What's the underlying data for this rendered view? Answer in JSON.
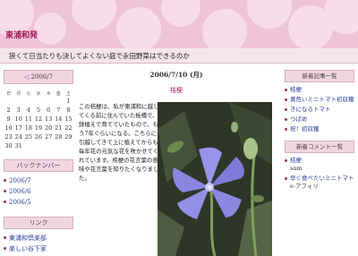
{
  "header": {
    "site_title": "東浦和発",
    "tagline": "狭くて日当たりも決してよくない庭で永田野菜はできるのか"
  },
  "calendar": {
    "prev_arrow": "◁",
    "title": "2006/7",
    "weekdays": [
      "日",
      "月",
      "火",
      "水",
      "木",
      "金",
      "土"
    ],
    "weeks": [
      [
        "",
        "",
        "",
        "",
        "",
        "",
        "1"
      ],
      [
        "2",
        "3",
        "4",
        "5",
        "6",
        "7",
        "8"
      ],
      [
        "9",
        "10",
        "11",
        "12",
        "13",
        "14",
        "15"
      ],
      [
        "16",
        "17",
        "18",
        "19",
        "20",
        "21",
        "22"
      ],
      [
        "23",
        "24",
        "25",
        "26",
        "27",
        "28",
        "29"
      ],
      [
        "30",
        "31",
        "",
        "",
        "",
        "",
        ""
      ]
    ]
  },
  "backnumber": {
    "heading": "バックナンバー",
    "items": [
      "2006/7",
      "2006/6",
      "2006/5"
    ]
  },
  "links": {
    "heading": "リンク",
    "items": [
      "東浦和倶楽部",
      "楽しい谷下家"
    ]
  },
  "article": {
    "date": "2006/7/10 (月)",
    "title": "桔梗",
    "body": "この桔梗は、私が東浦和に越してくる前に住んでいた板橋で、鉢植えで育てていたもので、もう7年ぐらいになる。こちらに引越してきて上に植えてからも毎年花の元気な花を咲かせてくれています。桔梗の花言葉の意味や花言葉を知りたくなりました。"
  },
  "recent_articles": {
    "heading": "新着記事一覧",
    "items": [
      "桔梗",
      "黄色いミニトマト初収穫",
      "きになるトマト",
      "つばめ",
      "祝！初収穫"
    ]
  },
  "recent_comments": {
    "heading": "新着コメント一覧",
    "items": [
      {
        "title": "桔梗",
        "author": "sam"
      },
      {
        "title": "早く食べたいミニトマト",
        "author": "e-アフィリ"
      }
    ]
  },
  "colors": {
    "accent": "#a3195b",
    "header_bg": "#efc4d8",
    "link": "#2a3f9a"
  }
}
